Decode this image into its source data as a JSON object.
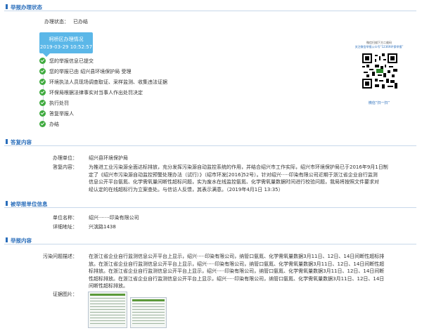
{
  "status_section": {
    "title": "举报办理状态",
    "state_label": "办理状态：",
    "state_value": "已办结",
    "status_box_title": "柯桥区办理情况",
    "status_box_time": "2019-03-29 10:52:57",
    "steps": [
      "您的举报信息已提交",
      "您的举报已由 绍兴县环境保护局 受理",
      "环境执法人员现场调查取证、采样监测、收集违法证据",
      "环保局根据法律事实对当事人作出处罚决定",
      "执行处罚",
      "答复举报人",
      "办结"
    ],
    "qr_caption_1": "微信扫描下方二维码",
    "qr_caption_2": "关注微信举报公众号“12369环保举报”",
    "qr_footer": "微信“扫一扫”"
  },
  "reply_section": {
    "title": "答复内容",
    "unit_label": "办理单位：",
    "unit_value": "绍兴县环境保护局",
    "content_label": "答复内容：",
    "content_lines": [
      "为推进工业污染源全面达标排放，充分发挥污染源自动监控系统的作用，并结合绍兴市工作实际，绍兴市环境保护局已于2016年9月1日制",
      "定了《绍兴市污染源自动监控预警处理办法（试行）》（绍市环发[2016]52号）。针对绍兴·····印染有限公司近期于浙江省企业自行监测",
      "信息公开平台氨氮、化学需氧量间断性超标问题，实为废水在线监控氨氮、化学需氧量数据时间进行校验问题，我局将按照文件要求对",
      "经认定的在线超标行为立案查处。与信访人反馈，其表示满意。（2019年4月1日  13:35）"
    ]
  },
  "reported_section": {
    "title": "被举报单位信息",
    "name_label": "单位名称：",
    "name_value": "绍兴·······印染有限公司",
    "addr_label": "详细地址：",
    "addr_value": "兴滨路1438"
  },
  "report_section": {
    "title": "举报内容",
    "desc_label": "污染问题描述：",
    "desc_lines": [
      "在浙江省企业自行监测信息公开平台上显示，绍兴·····印染有限公司，纳管口氨氮、化学需氧量数据3月11日、12日、14日间断性超标排",
      "放。在浙江省企业自行监测信息公开平台上显示，绍兴·····印染有限公司，纳管口氨氮、化学需氧量数据3月11日、12日、14日间断性超",
      "标排放。在浙江省企业自行监测信息公开平台上显示，绍兴·····印染有限公司，纳管口氨氮、化学需氧量数据3月11日、12日、14日间断",
      "性超标排放。在浙江省企业自行监测信息公开平台上显示，绍兴·····印染有限公司，纳管口氨氮、化学需氧量数据3月11日、12日、14日",
      "间断性超标排放。"
    ],
    "evidence_label": "证据图片："
  },
  "colors": {
    "accent": "#2a6ebb",
    "status_box": "#5bb7e8",
    "step_done": "#3eaa3e"
  }
}
